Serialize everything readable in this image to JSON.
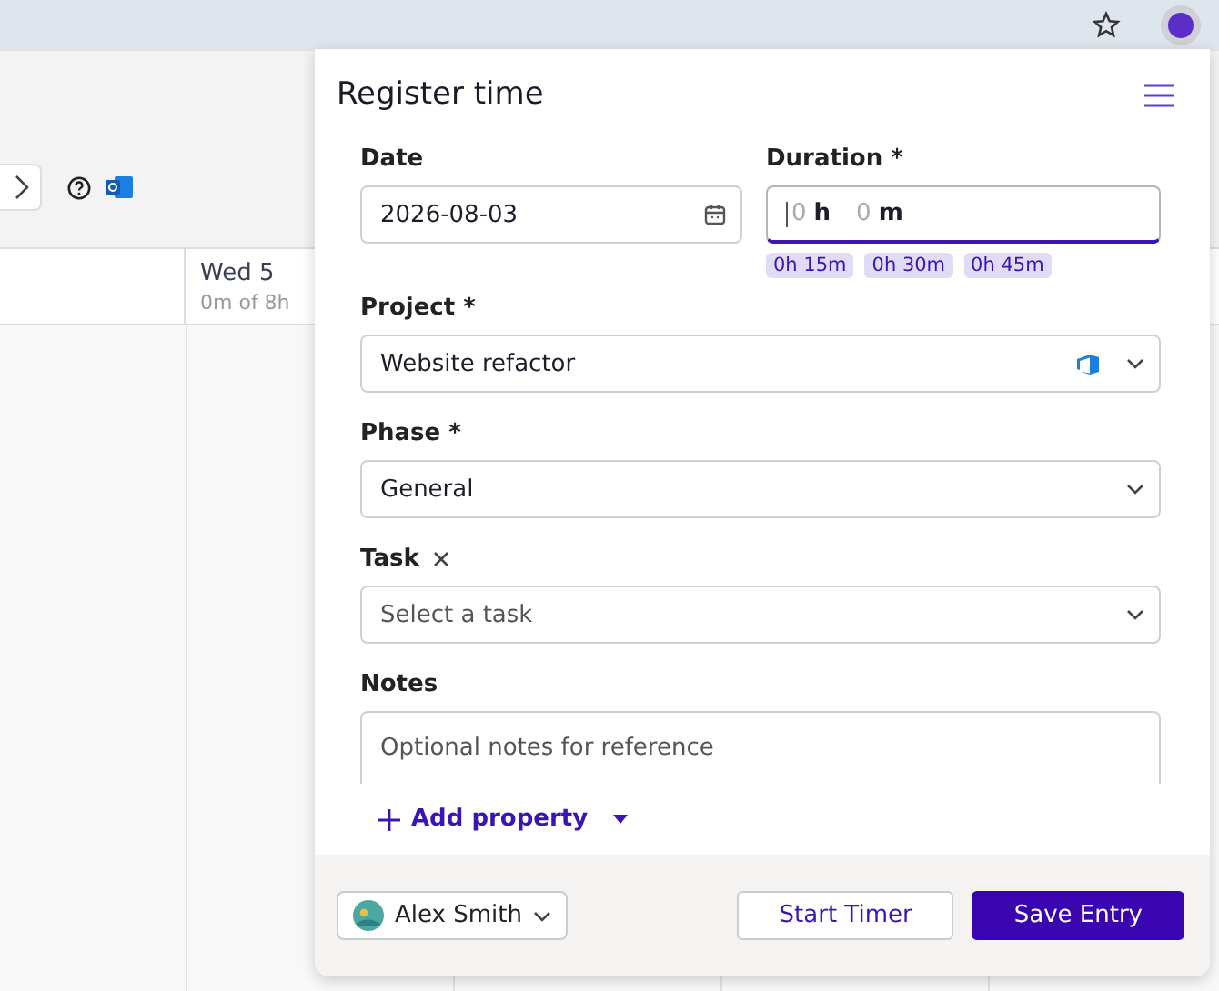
{
  "calendar": {
    "days": [
      {
        "name": "Wed 5",
        "summary": "0m of 8h"
      }
    ]
  },
  "panel": {
    "title": "Register time",
    "fields": [
      {
        "kind": "date",
        "label": "Date",
        "value": "2026-08-03"
      },
      {
        "kind": "duration",
        "label": "Duration *",
        "focused": true,
        "hours_placeholder": "0",
        "hours_unit": "h",
        "minutes_placeholder": "0",
        "minutes_unit": "m",
        "presets": [
          "0h 15m",
          "0h 30m",
          "0h 45m"
        ]
      },
      {
        "kind": "select",
        "label": "Project *",
        "value": "Website refactor",
        "integration": true
      },
      {
        "kind": "select",
        "label": "Phase *",
        "value": "General"
      },
      {
        "kind": "select",
        "label": "Task",
        "placeholder": "Select a task",
        "clearable": true
      },
      {
        "kind": "textarea",
        "label": "Notes",
        "placeholder": "Optional notes for reference"
      }
    ],
    "add_property": "Add property",
    "user": "Alex Smith",
    "buttons": [
      {
        "kind": "secondary",
        "label": "Start Timer"
      },
      {
        "kind": "primary",
        "label": "Save Entry"
      }
    ]
  }
}
